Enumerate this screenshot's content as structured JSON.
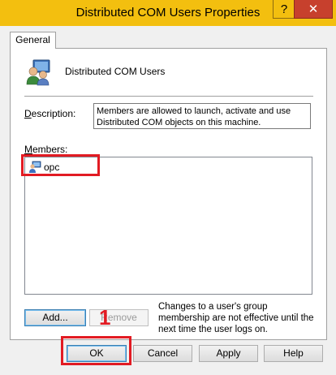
{
  "window": {
    "title": "Distributed COM Users Properties",
    "help_label": "?",
    "close_label": "✕"
  },
  "tabs": [
    {
      "label": "General"
    }
  ],
  "group": {
    "name": "Distributed COM Users",
    "description_label": "Description:",
    "description_value": "Members are allowed to launch, activate and use Distributed COM objects on this machine."
  },
  "members": {
    "label": "Members:",
    "items": [
      {
        "name": "opc"
      }
    ]
  },
  "actions": {
    "add_label": "Add...",
    "remove_label": "Remove",
    "note": "Changes to a user's group membership are not effective until the next time the user logs on."
  },
  "annotation": {
    "step": "1",
    "color": "#e21b23"
  },
  "footer": {
    "ok_label": "OK",
    "cancel_label": "Cancel",
    "apply_label": "Apply",
    "help_label": "Help"
  },
  "colors": {
    "titlebar": "#f3bf0f",
    "close_button": "#c7402d"
  }
}
